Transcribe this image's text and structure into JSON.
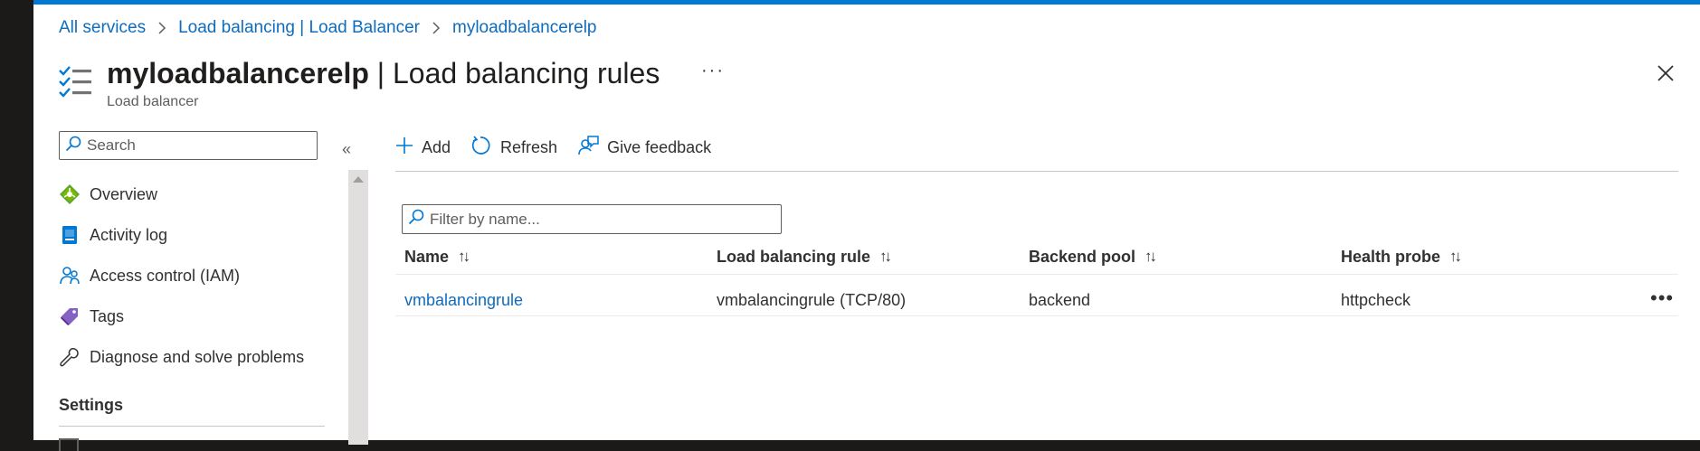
{
  "breadcrumb": [
    "All services",
    "Load balancing | Load Balancer",
    "myloadbalancerelp"
  ],
  "header": {
    "resource_name": "myloadbalancerelp",
    "page_title": "Load balancing rules",
    "more": "···",
    "subtitle": "Load balancer"
  },
  "sidebar": {
    "search_placeholder": "Search",
    "collapse": "«",
    "items": [
      {
        "label": "Overview",
        "icon": "overview-icon"
      },
      {
        "label": "Activity log",
        "icon": "activity-log-icon"
      },
      {
        "label": "Access control (IAM)",
        "icon": "access-control-icon"
      },
      {
        "label": "Tags",
        "icon": "tag-icon"
      },
      {
        "label": "Diagnose and solve problems",
        "icon": "wrench-icon"
      }
    ],
    "section_settings": "Settings"
  },
  "toolbar": {
    "add_label": "Add",
    "refresh_label": "Refresh",
    "feedback_label": "Give feedback"
  },
  "filter": {
    "placeholder": "Filter by name..."
  },
  "table": {
    "sort_glyph": "↑↓",
    "columns": [
      "Name",
      "Load balancing rule",
      "Backend pool",
      "Health probe"
    ],
    "rows": [
      {
        "name": "vmbalancingrule",
        "rule": "vmbalancingrule (TCP/80)",
        "backend_pool": "backend",
        "health_probe": "httpcheck"
      }
    ],
    "row_more": "•••"
  },
  "colors": {
    "accent": "#0078d4",
    "link": "#0f6cbd",
    "text": "#323130",
    "muted": "#605e5c"
  }
}
